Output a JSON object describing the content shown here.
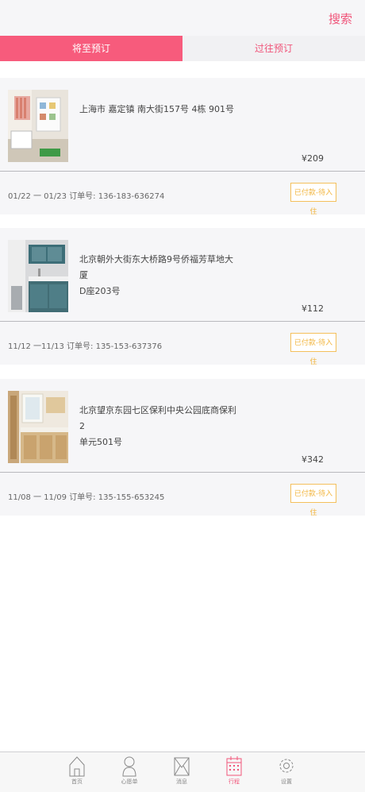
{
  "header": {
    "search_label": "搜索"
  },
  "tabs": [
    {
      "label": "将至预订",
      "active": true
    },
    {
      "label": "过往预订",
      "active": false
    }
  ],
  "bookings": [
    {
      "address_line1": "上海市 嘉定镇 南大街157号 4栋 901号",
      "address_line2": "",
      "price": "¥209",
      "dates": "01/22 一 01/23",
      "order_label": "订单号:",
      "order_no": "136-183-636274",
      "status": "已付款-待入住"
    },
    {
      "address_line1": "北京朝外大街东大桥路9号侨福芳草地大厦",
      "address_line2": "D座203号",
      "price": "¥112",
      "dates": "11/12 一11/13",
      "order_label": "订单号:",
      "order_no": "135-153-637376",
      "status": "已付款-待入住"
    },
    {
      "address_line1": "北京望京东园七区保利中央公园底商保利2",
      "address_line2": "单元501号",
      "price": "¥342",
      "dates": "11/08 一 11/09",
      "order_label": "订单号:",
      "order_no": "135-155-653245",
      "status": "已付款-待入住"
    }
  ],
  "tabbar": [
    {
      "label": "首页",
      "icon": "home-icon",
      "active": false
    },
    {
      "label": "心愿单",
      "icon": "wishlist-icon",
      "active": false
    },
    {
      "label": "消息",
      "icon": "message-icon",
      "active": false
    },
    {
      "label": "行程",
      "icon": "calendar-icon",
      "active": true
    },
    {
      "label": "设置",
      "icon": "gear-icon",
      "active": false
    }
  ],
  "colors": {
    "accent": "#f75b7c",
    "status": "#f2b640",
    "card_bg": "#f6f6f8"
  }
}
